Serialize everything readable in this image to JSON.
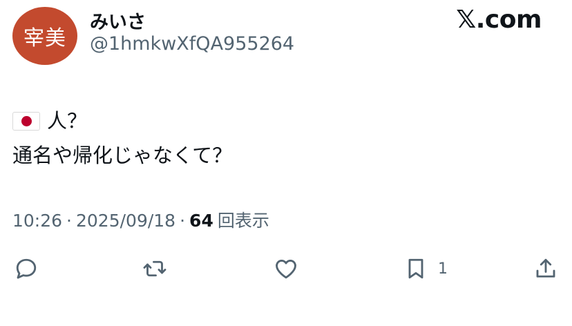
{
  "author": {
    "avatar_text": "宰美",
    "avatar_color": "#c34a2e",
    "display_name": "みいさ",
    "handle": "@1hmkwXfQA955264"
  },
  "brand": {
    "logo_text": "𝕏.com"
  },
  "tweet": {
    "line1_text": "人？",
    "line2_text": "通名や帰化じゃなくて？",
    "flag_icon": "japan-flag-icon"
  },
  "meta": {
    "time": "10:26",
    "sep1": "·",
    "date": "2025/09/18",
    "sep2": "·",
    "views_count": "64",
    "views_label": "回表示"
  },
  "actions": {
    "reply_icon": "reply-icon",
    "retweet_icon": "retweet-icon",
    "like_icon": "heart-icon",
    "bookmark_icon": "bookmark-icon",
    "bookmark_count": "1",
    "share_icon": "share-icon"
  },
  "colors": {
    "text_primary": "#0f1419",
    "text_secondary": "#536471",
    "flag_red": "#bc002d"
  }
}
